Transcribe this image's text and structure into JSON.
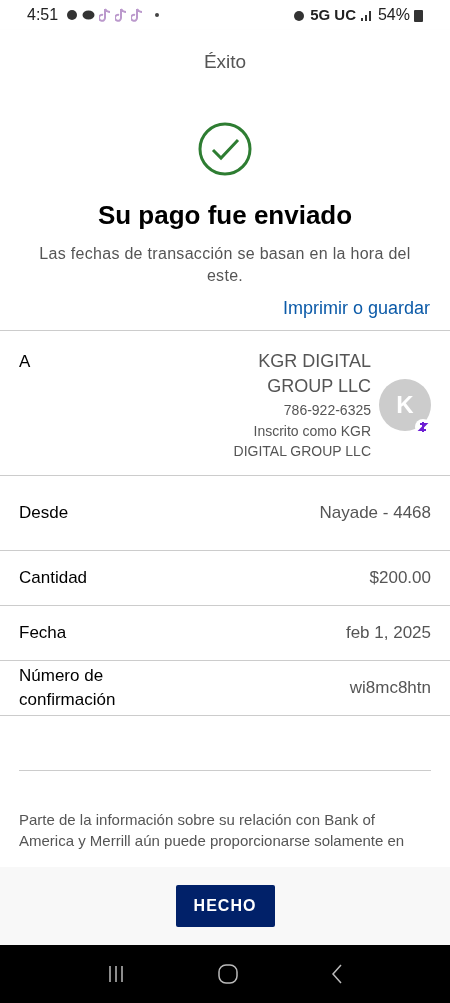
{
  "status_bar": {
    "time": "4:51",
    "network": "5G UC",
    "battery": "54%"
  },
  "header": {
    "title": "Éxito"
  },
  "success": {
    "title": "Su pago fue enviado",
    "subtitle": "Las fechas de transacción se basan en la hora del este.",
    "link": "Imprimir o guardar"
  },
  "recipient": {
    "label": "A",
    "name": "KGR DIGITAL GROUP LLC",
    "phone": "786-922-6325",
    "enrolled": "Inscrito como KGR DIGITAL GROUP LLC",
    "avatar": "K"
  },
  "details": [
    {
      "label": "Desde",
      "value": "Nayade - 4468"
    },
    {
      "label": "Cantidad",
      "value": "$200.00"
    },
    {
      "label": "Fecha",
      "value": "feb 1, 2025"
    },
    {
      "label": "Número de confirmación",
      "value": "wi8mc8htn"
    }
  ],
  "disclaimer": "Parte de la información sobre su relación con Bank of America y Merrill aún puede proporcionarse solamente en",
  "footer": {
    "button": "HECHO"
  }
}
